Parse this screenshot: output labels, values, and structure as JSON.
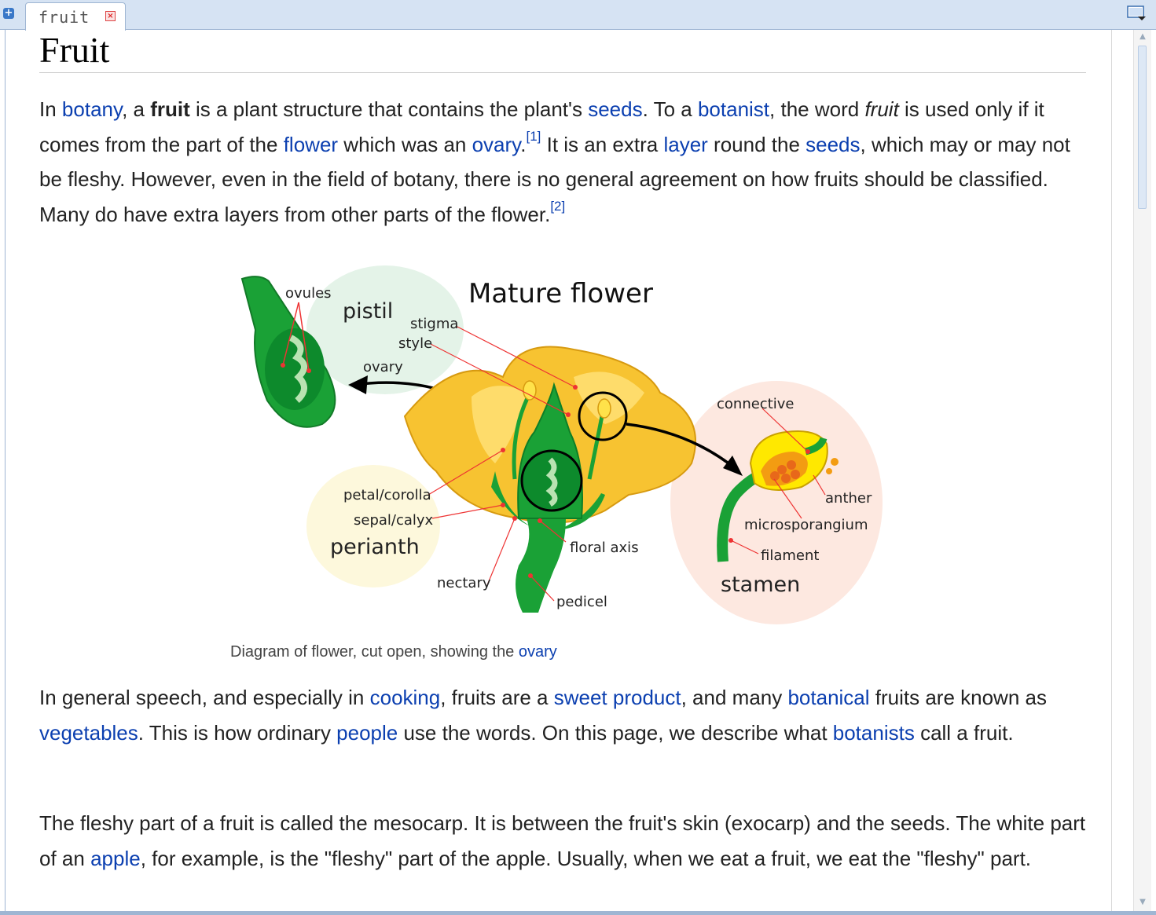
{
  "tab": {
    "title": "fruit",
    "add_icon": "+",
    "close_icon": "×"
  },
  "page": {
    "title": "Fruit",
    "p1": {
      "t1": "In ",
      "l_botany": "botany",
      "t2": ", a ",
      "b_fruit": "fruit",
      "t3": " is a plant structure that contains the plant's ",
      "l_seeds": "seeds",
      "t4": ". To a ",
      "l_botanist": "botanist",
      "t5": ", the word ",
      "i_fruit": "fruit",
      "t6": " is used only if it comes from the part of the ",
      "l_flower": "flower",
      "t7": " which was an ",
      "l_ovary": "ovary",
      "t8": ".",
      "ref1": "[1]",
      "t9": " It is an extra ",
      "l_layer": "layer",
      "t10": " round the ",
      "l_seeds2": "seeds",
      "t11": ", which may or may not be fleshy. However, even in the field of botany, there is no general agreement on how fruits should be classified. Many do have extra layers from other parts of the flower.",
      "ref2": "[2]"
    },
    "figure": {
      "title": "Mature flower",
      "labels": {
        "ovules": "ovules",
        "pistil": "pistil",
        "stigma": "stigma",
        "style": "style",
        "ovary": "ovary",
        "connective": "connective",
        "anther": "anther",
        "microsporangium": "microsporangium",
        "filament": "filament",
        "stamen": "stamen",
        "petal": "petal/corolla",
        "sepal": "sepal/calyx",
        "perianth": "perianth",
        "floral_axis": "floral axis",
        "nectary": "nectary",
        "pedicel": "pedicel"
      },
      "caption_text": "Diagram of flower, cut open, showing the ",
      "caption_link": "ovary"
    },
    "p2": {
      "t1": "In general speech, and especially in ",
      "l_cooking": "cooking",
      "t2": ", fruits are a ",
      "l_sweet": "sweet product",
      "t3": ", and many ",
      "l_botanical": "botanical",
      "t4": " fruits are known as ",
      "l_vegetables": "vegetables",
      "t5": ". This is how ordinary ",
      "l_people": "people",
      "t6": " use the words. On this page, we describe what ",
      "l_botanists": "botanists",
      "t7": " call a fruit."
    },
    "p3": {
      "t1": "The fleshy part of a fruit is called the mesocarp. It is between the fruit's skin (exocarp) and the seeds. The white part of an ",
      "l_apple": "apple",
      "t2": ", for example, is the \"fleshy\" part of the apple. Usually, when we eat a fruit, we eat the \"fleshy\" part."
    }
  },
  "colors": {
    "link": "#0b3fb0",
    "tabbar": "#d6e3f3",
    "petal": "#f7c331",
    "stem": "#1aa136"
  },
  "icons": [
    "add-tab-icon",
    "close-tab-icon",
    "tab-list-icon",
    "scroll-up-icon",
    "scroll-down-icon"
  ]
}
